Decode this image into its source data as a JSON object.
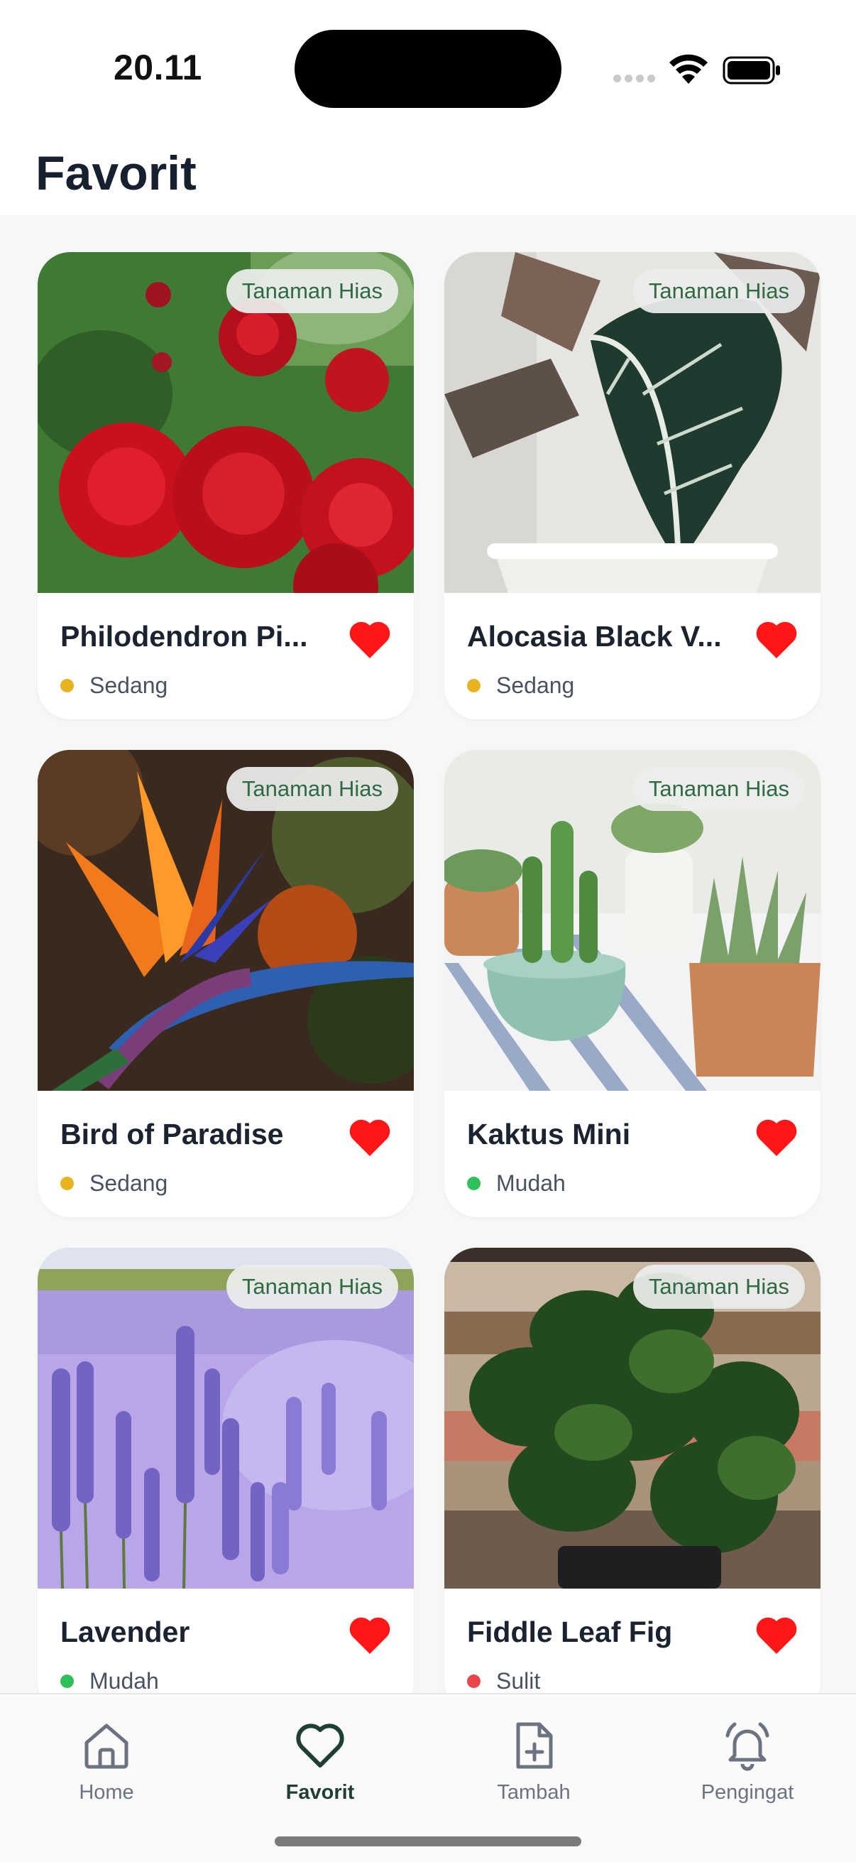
{
  "status_bar": {
    "time": "20.11"
  },
  "header": {
    "title": "Favorit"
  },
  "cards": [
    {
      "name": "Philodendron Pi...",
      "category": "Tanaman Hias",
      "level": "Sedang",
      "level_color": "#e8b320",
      "favorited": true,
      "image": "red-roses"
    },
    {
      "name": "Alocasia Black V...",
      "category": "Tanaman Hias",
      "level": "Sedang",
      "level_color": "#e8b320",
      "favorited": true,
      "image": "alocasia-leaf"
    },
    {
      "name": "Bird of Paradise",
      "category": "Tanaman Hias",
      "level": "Sedang",
      "level_color": "#e8b320",
      "favorited": true,
      "image": "bird-of-paradise-flower"
    },
    {
      "name": "Kaktus Mini",
      "category": "Tanaman Hias",
      "level": "Mudah",
      "level_color": "#2ec05a",
      "favorited": true,
      "image": "mini-cactus-pots"
    },
    {
      "name": "Lavender",
      "category": "Tanaman Hias",
      "level": "Mudah",
      "level_color": "#2ec05a",
      "favorited": true,
      "image": "lavender-field"
    },
    {
      "name": "Fiddle Leaf Fig",
      "category": "Tanaman Hias",
      "level": "Sulit",
      "level_color": "#e8464b",
      "favorited": true,
      "image": "fiddle-leaf-fig"
    }
  ],
  "bottom_nav": {
    "items": [
      {
        "label": "Home",
        "icon": "home-icon",
        "active": false
      },
      {
        "label": "Favorit",
        "icon": "heart-icon",
        "active": true
      },
      {
        "label": "Tambah",
        "icon": "add-file-icon",
        "active": false
      },
      {
        "label": "Pengingat",
        "icon": "bell-icon",
        "active": false
      }
    ]
  },
  "colors": {
    "favorite": "#ff1717",
    "accent": "#1f3f33",
    "badge_text": "#2f6a45",
    "background": "#f6f8f7"
  }
}
